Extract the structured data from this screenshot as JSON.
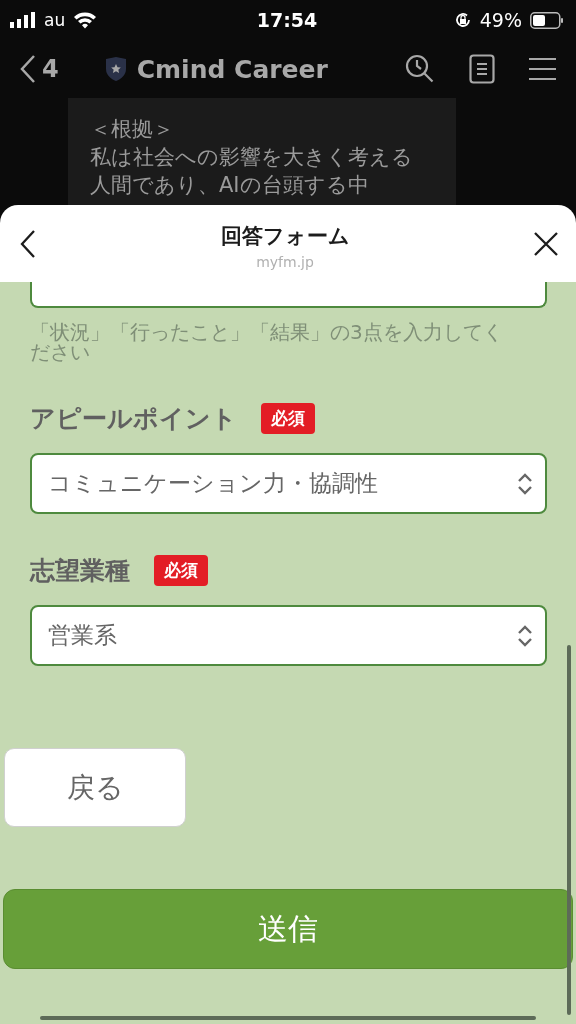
{
  "status_bar": {
    "carrier": "au",
    "time": "17:54",
    "battery": "49%"
  },
  "nav": {
    "back_count": "4",
    "title": "Cmind Career"
  },
  "chat_bubble": {
    "lines": [
      "＜根拠＞",
      "私は社会への影響を大きく考える",
      "人間であり、AIの台頭する中"
    ]
  },
  "sheet": {
    "title": "回答フォーム",
    "url": "myfm.jp"
  },
  "form": {
    "items": [
      {
        "kind": "textarea",
        "hint": "「状況」「行ったこと」「結果」の3点を入力してください"
      },
      {
        "kind": "select",
        "label": "アピールポイント",
        "required": true,
        "required_label": "必須",
        "value": "コミュニケーション力・協調性"
      },
      {
        "kind": "select",
        "label": "志望業種",
        "required": true,
        "required_label": "必須",
        "value": "営業系"
      }
    ]
  },
  "buttons": {
    "back": "戻る",
    "submit": "送信"
  }
}
